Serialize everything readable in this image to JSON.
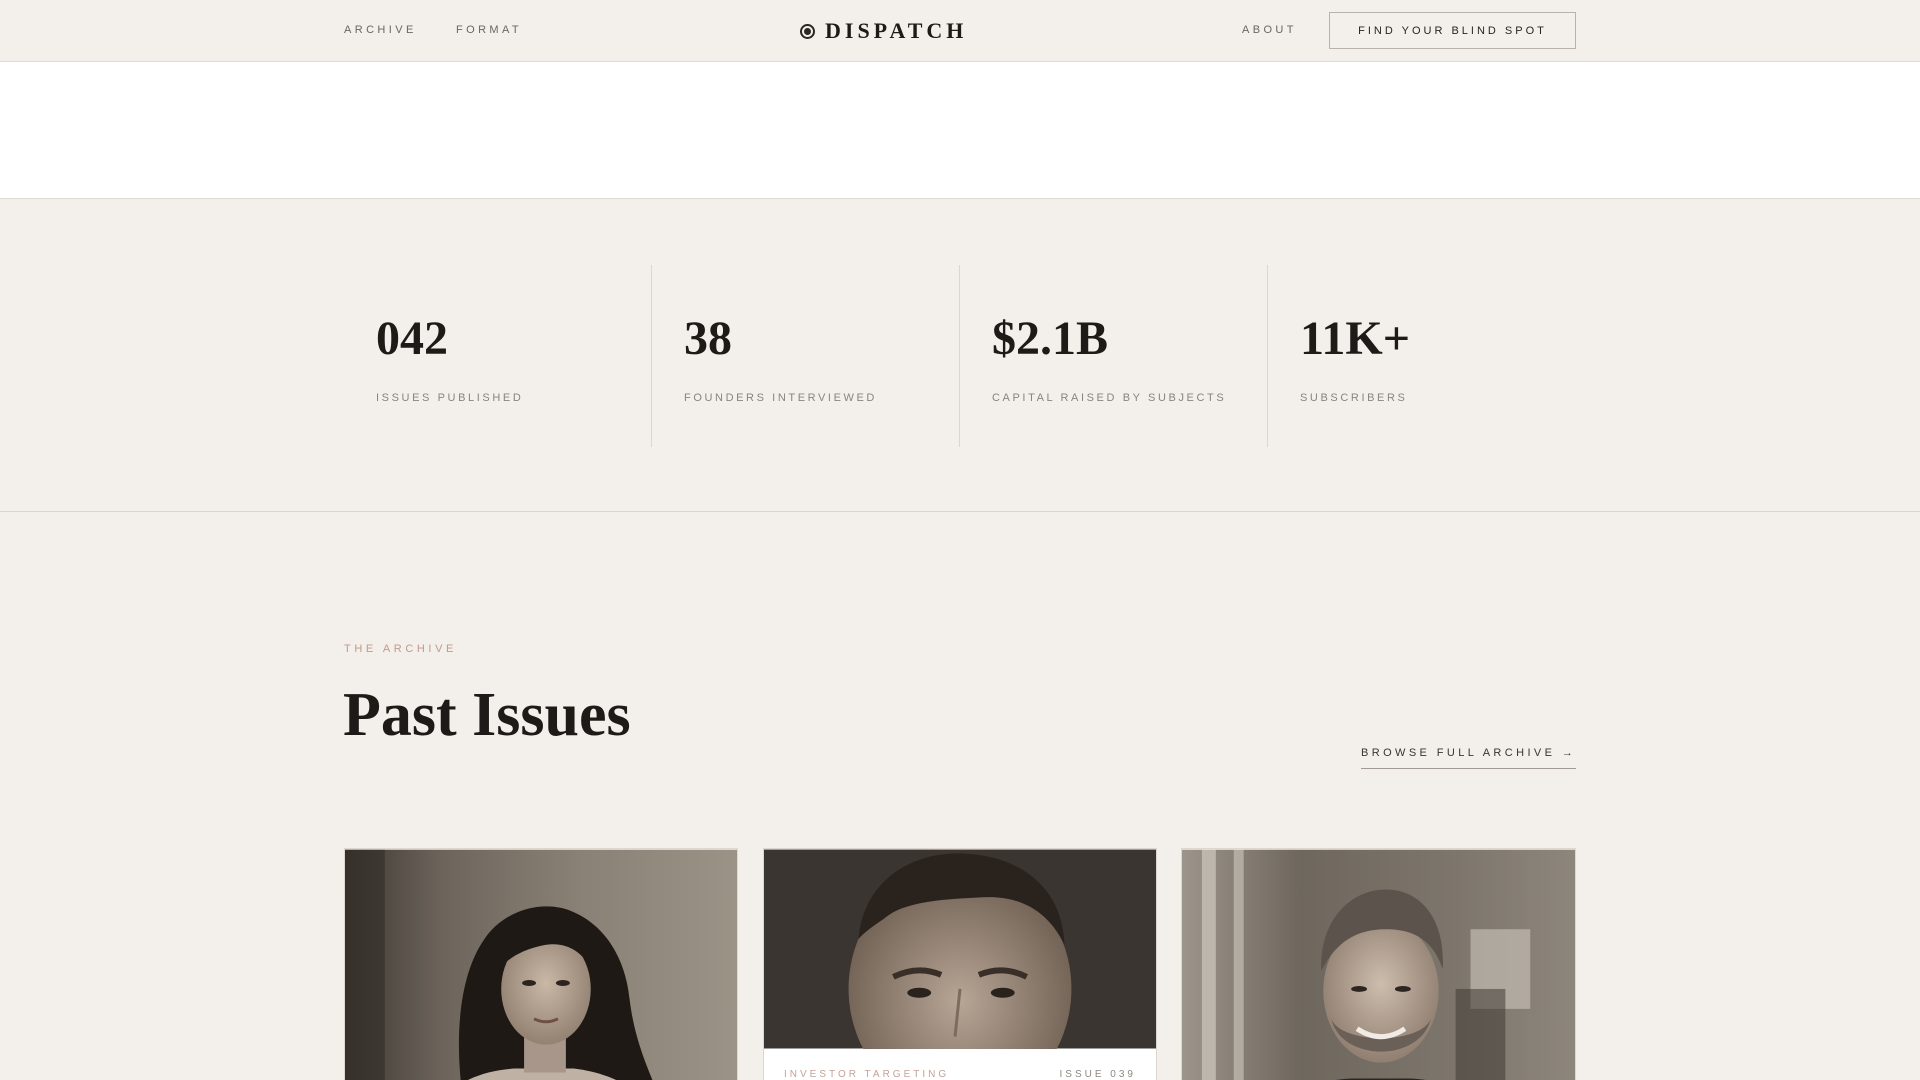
{
  "nav": {
    "links": [
      "ARCHIVE",
      "FORMAT"
    ],
    "brand": "DISPATCH",
    "about": "ABOUT",
    "cta": "FIND YOUR BLIND SPOT"
  },
  "stats": [
    {
      "value": "042",
      "label": "ISSUES PUBLISHED"
    },
    {
      "value": "38",
      "label": "FOUNDERS INTERVIEWED"
    },
    {
      "value": "$2.1B",
      "label": "CAPITAL RAISED BY SUBJECTS"
    },
    {
      "value": "11K+",
      "label": "SUBSCRIBERS"
    }
  ],
  "archive": {
    "eyebrow": "THE ARCHIVE",
    "title": "Past Issues",
    "browse": "BROWSE FULL ARCHIVE →"
  },
  "cards": [
    {
      "tag": "",
      "issue": ""
    },
    {
      "tag": "INVESTOR TARGETING",
      "issue": "ISSUE 039"
    },
    {
      "tag": "",
      "issue": ""
    }
  ],
  "colors": {
    "background": "#f3efea",
    "accent": "#c29a8e",
    "ink": "#1e1a17"
  }
}
